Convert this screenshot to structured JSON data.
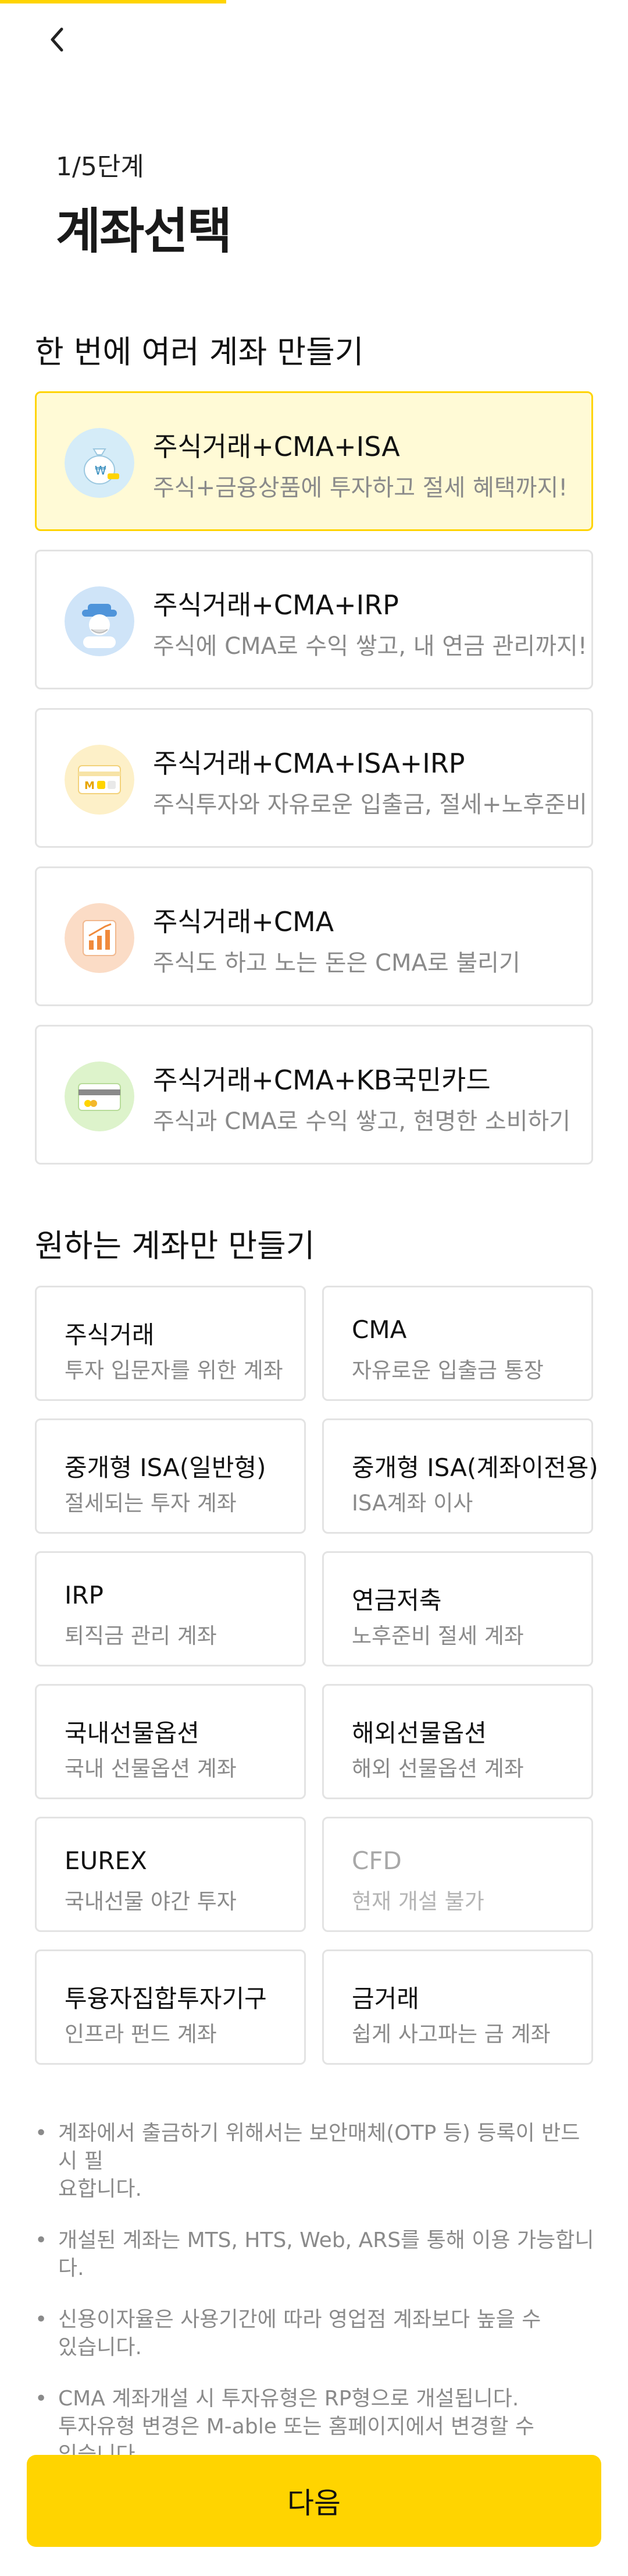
{
  "header": {
    "step": "1/5단계",
    "title": "계좌선택"
  },
  "bundle_section": {
    "heading": "한 번에 여러 계좌 만들기",
    "items": [
      {
        "title": "주식거래+CMA+ISA",
        "desc": "주식+금융상품에 투자하고 절세 혜택까지!",
        "icon": "money-bag-icon"
      },
      {
        "title": "주식거래+CMA+IRP",
        "desc": "주식에 CMA로 수익 쌓고, 내 연금 관리까지!",
        "icon": "retiree-icon"
      },
      {
        "title": "주식거래+CMA+ISA+IRP",
        "desc": "주식투자와 자유로운 입출금, 절세+노후준비",
        "icon": "card-combo-icon"
      },
      {
        "title": "주식거래+CMA",
        "desc": "주식도 하고 노는 돈은 CMA로 불리기",
        "icon": "growth-chart-icon"
      },
      {
        "title": "주식거래+CMA+KB국민카드",
        "desc": "주식과 CMA로 수익 쌓고, 현명한 소비하기",
        "icon": "credit-card-icon"
      }
    ]
  },
  "single_section": {
    "heading": "원하는 계좌만 만들기",
    "items": [
      {
        "title": "주식거래",
        "desc": "투자 입문자를 위한 계좌"
      },
      {
        "title": "CMA",
        "desc": "자유로운 입출금 통장"
      },
      {
        "title": "중개형 ISA(일반형)",
        "desc": "절세되는 투자 계좌"
      },
      {
        "title": "중개형 ISA(계좌이전용)",
        "desc": "ISA계좌 이사"
      },
      {
        "title": "IRP",
        "desc": "퇴직금 관리 계좌"
      },
      {
        "title": "연금저축",
        "desc": "노후준비 절세 계좌"
      },
      {
        "title": "국내선물옵션",
        "desc": "국내 선물옵션 계좌"
      },
      {
        "title": "해외선물옵션",
        "desc": "해외 선물옵션 계좌"
      },
      {
        "title": "EUREX",
        "desc": "국내선물 야간 투자"
      },
      {
        "title": "CFD",
        "desc": "현재 개설 불가"
      },
      {
        "title": "투융자집합투자기구",
        "desc": "인프라 펀드 계좌"
      },
      {
        "title": "금거래",
        "desc": "쉽게 사고파는 금 계좌"
      }
    ]
  },
  "notes": {
    "bullet": "•",
    "n0l0": "계좌에서 출금하기 위해서는 보안매체(OTP 등) 등록이 반드시 필",
    "n0l1": "요합니다.",
    "n1l0": "개설된 계좌는 MTS, HTS, Web, ARS를 통해 이용 가능합니다.",
    "n2l0": "신용이자율은 사용기간에 따라 영업점 계좌보다 높을 수",
    "n2l1": "있습니다.",
    "n3l0": "CMA 계좌개설 시 투자유형은 RP형으로 개설됩니다.",
    "n3l1": "투자유형 변경은 M-able 또는 홈페이지에서 변경할 수",
    "n3l2": "있습니다."
  },
  "footer": {
    "next_label": "다음"
  },
  "progress": {
    "fraction": 0.2
  },
  "colors": {
    "accent": "#FFD400",
    "selected_bg": "#FFFAD6",
    "border": "#E3E3E3",
    "muted_text": "#8A8A8A"
  }
}
